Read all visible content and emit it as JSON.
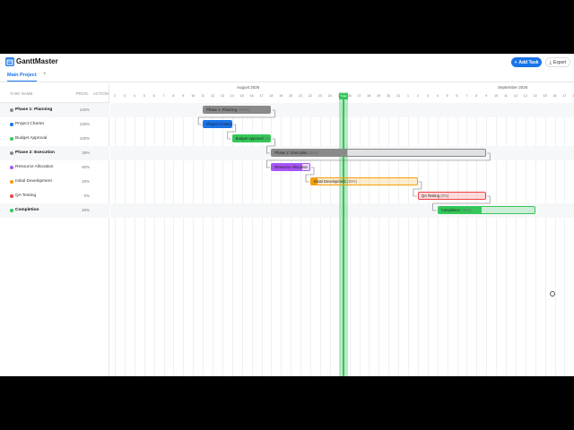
{
  "app": {
    "title": "GanttMaster"
  },
  "toolbar": {
    "add_label": "Add Task",
    "export_label": "Export"
  },
  "tabs": [
    {
      "label": "Main Project"
    }
  ],
  "tab_add_label": "+",
  "columns": {
    "name": "TASK NAME",
    "progress": "PROG.",
    "action": "ACTION"
  },
  "months": [
    {
      "label": "August 2026"
    },
    {
      "label": "September 2026"
    }
  ],
  "days_aug": [
    "2",
    "3",
    "4",
    "5",
    "6",
    "7",
    "8",
    "9",
    "10",
    "11",
    "12",
    "13",
    "14",
    "15",
    "16",
    "17",
    "18",
    "19",
    "20",
    "21",
    "22",
    "23",
    "24",
    "25",
    "26",
    "27",
    "28",
    "29",
    "30",
    "31"
  ],
  "days_sep": [
    "1",
    "2",
    "3",
    "4",
    "5",
    "6",
    "7",
    "8",
    "9",
    "10",
    "11",
    "12",
    "13",
    "14",
    "15",
    "16",
    "17",
    "18",
    "19",
    "20",
    "21",
    "22",
    "23",
    "24",
    "25",
    "26",
    "27",
    "28",
    "29",
    "30"
  ],
  "today_label": "Today",
  "tasks": [
    {
      "name": "Phase 1: Planning",
      "progress": "100%",
      "phase": true,
      "color": "#8a8a8a",
      "bar_label": "Phase 1: Planning",
      "bar_pct": "(100%)",
      "start": 9,
      "end": 16,
      "done": 1.0
    },
    {
      "name": "Project Charter",
      "progress": "100%",
      "phase": false,
      "color": "#1a73e8",
      "bar_label": "Project Charter",
      "bar_pct": "",
      "start": 9,
      "end": 12,
      "done": 1.0
    },
    {
      "name": "Budget Approval",
      "progress": "100%",
      "phase": false,
      "color": "#34c759",
      "bar_label": "Budget Approval",
      "bar_pct": "(10",
      "start": 12,
      "end": 16,
      "done": 1.0
    },
    {
      "name": "Phase 2: Execution",
      "progress": "35%",
      "phase": true,
      "color": "#8a8a8a",
      "bar_label": "Phase 2: Execution",
      "bar_pct": "(35%)",
      "start": 16,
      "end": 38,
      "done": 0.35
    },
    {
      "name": "Resource Allocation",
      "progress": "60%",
      "phase": false,
      "color": "#a855f7",
      "bar_label": "Resource Allocation",
      "bar_pct": "",
      "start": 16,
      "end": 20,
      "done": 0.8
    },
    {
      "name": "Initial Development",
      "progress": "20%",
      "phase": false,
      "color": "#f59e0b",
      "bar_label": "Initial Development",
      "bar_pct": "(20%)",
      "start": 20,
      "end": 31,
      "done": 0.06
    },
    {
      "name": "QA Testing",
      "progress": "0%",
      "phase": false,
      "color": "#ef4444",
      "bar_label": "QA Testing",
      "bar_pct": "(0%)",
      "start": 31,
      "end": 38,
      "done": 0.0
    },
    {
      "name": "Completion",
      "progress": "40%",
      "phase": true,
      "color": "#34c759",
      "bar_label": "Completion",
      "bar_pct": "(40%)",
      "start": 33,
      "end": 43,
      "done": 0.45
    }
  ]
}
